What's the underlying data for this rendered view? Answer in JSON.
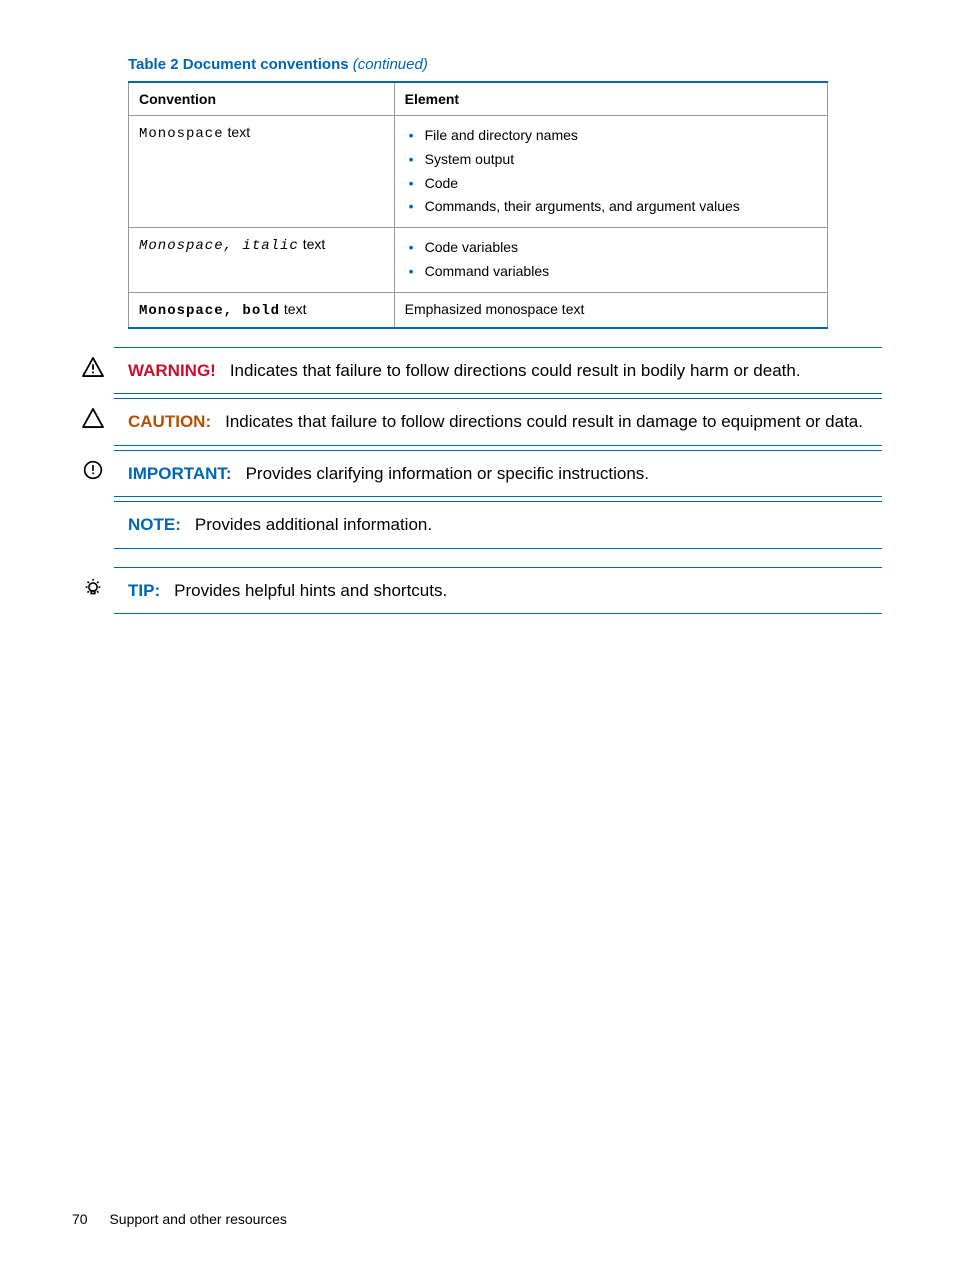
{
  "table": {
    "caption_prefix": "Table 2 Document conventions",
    "caption_suffix": "(continued)",
    "headers": {
      "c0": "Convention",
      "c1": "Element"
    },
    "rows": [
      {
        "conv_mono": "Monospace",
        "conv_tail": " text",
        "items": [
          "File and directory names",
          "System output",
          "Code",
          "Commands, their arguments, and argument values"
        ]
      },
      {
        "conv_mono": "Monospace, italic",
        "conv_tail": " text",
        "items": [
          "Code variables",
          "Command variables"
        ]
      },
      {
        "conv_mono": "Monospace, bold",
        "conv_tail": " text",
        "plain": "Emphasized monospace text"
      }
    ]
  },
  "admonitions": [
    {
      "icon": "warning",
      "label": "WARNING!",
      "label_class": "label-red",
      "text": "Indicates that failure to follow directions could result in bodily harm or death."
    },
    {
      "icon": "caution",
      "label": "CAUTION:",
      "label_class": "label-amber",
      "text": "Indicates that failure to follow directions could result in damage to equipment or data."
    },
    {
      "icon": "important",
      "label": "IMPORTANT:",
      "label_class": "label-blue",
      "text": "Provides clarifying information or specific instructions."
    },
    {
      "icon": "",
      "label": "NOTE:",
      "label_class": "label-blue",
      "text": "Provides additional information."
    },
    {
      "icon": "tip",
      "label": "TIP:",
      "label_class": "label-blue",
      "text": "Provides helpful hints and shortcuts.",
      "gap_before": true
    }
  ],
  "footer": {
    "page": "70",
    "section": "Support and other resources"
  }
}
